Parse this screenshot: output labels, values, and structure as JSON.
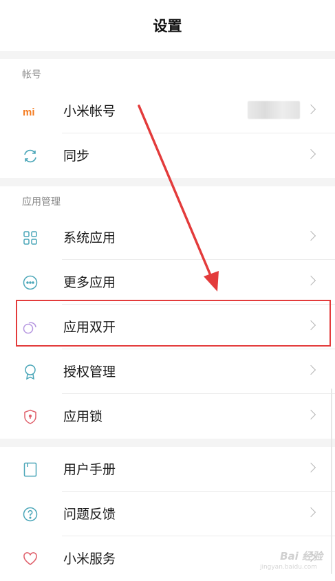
{
  "header": {
    "title": "设置"
  },
  "sections": [
    {
      "label": "帐号"
    },
    {
      "label": "应用管理"
    }
  ],
  "rows": {
    "account": {
      "label": "小米帐号",
      "icon": "mi-logo-icon"
    },
    "sync": {
      "label": "同步",
      "icon": "sync-icon"
    },
    "system_apps": {
      "label": "系统应用",
      "icon": "grid-icon"
    },
    "more_apps": {
      "label": "更多应用",
      "icon": "more-circle-icon"
    },
    "dual_apps": {
      "label": "应用双开",
      "icon": "dual-circles-icon"
    },
    "permissions": {
      "label": "授权管理",
      "icon": "badge-icon"
    },
    "app_lock": {
      "label": "应用锁",
      "icon": "shield-lock-icon"
    },
    "user_guide": {
      "label": "用户手册",
      "icon": "book-icon"
    },
    "feedback": {
      "label": "问题反馈",
      "icon": "question-icon"
    },
    "mi_services": {
      "label": "小米服务",
      "icon": "heart-icon"
    }
  },
  "watermark": {
    "text": "Bai 经验",
    "sub": "jingyan.baidu.com"
  },
  "colors": {
    "highlight": "#e33b3b",
    "orange": "#f47b20",
    "teal": "#4aa6b8",
    "purple": "#b596e0",
    "red": "#e0616c"
  }
}
